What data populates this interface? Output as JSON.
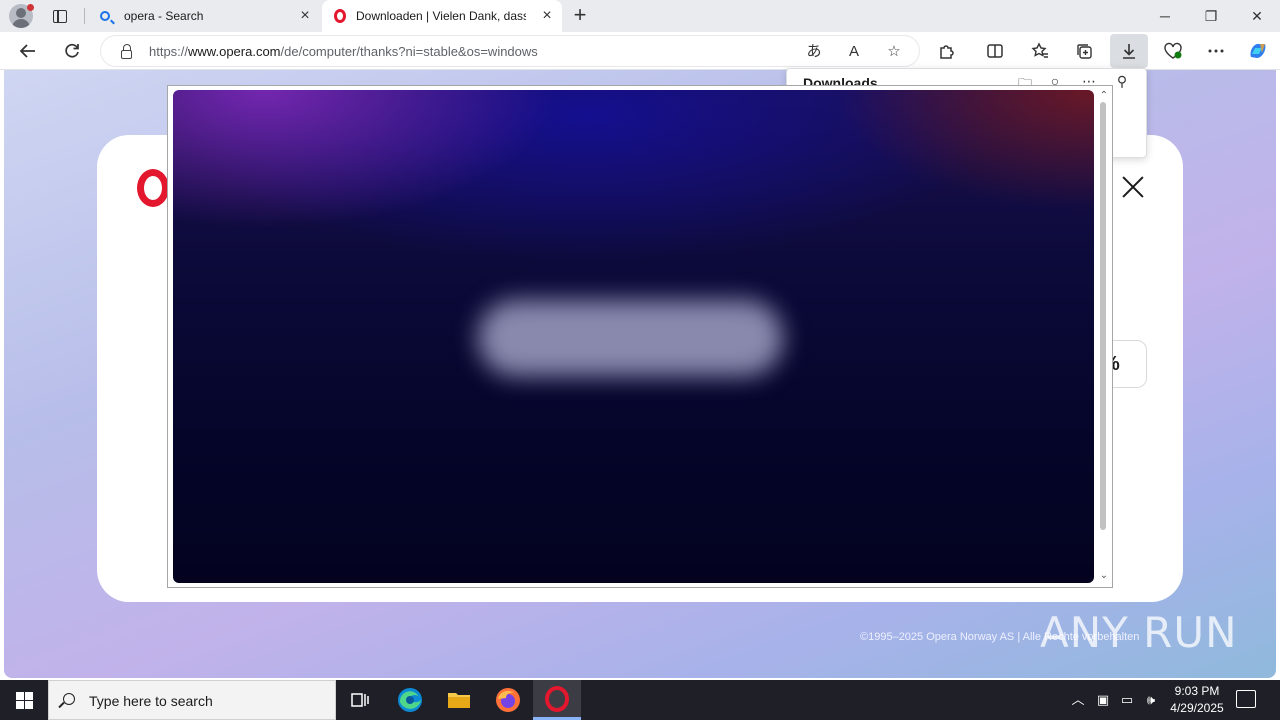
{
  "browser": {
    "tabs": [
      {
        "label": "opera - Search",
        "icon": "search-icon"
      },
      {
        "label": "Downloaden | Vielen Dank, dass Sie",
        "icon": "opera-icon",
        "active": true
      }
    ],
    "window_controls": {
      "minimize": "─",
      "restore": "❐",
      "close": "✕"
    },
    "address_bar": {
      "url_prefix": "https://",
      "url_domain": "www.opera.com",
      "url_path": "/de/computer/thanks?ni=stable&os=windows"
    }
  },
  "downloads_panel": {
    "title": "Downloads"
  },
  "page": {
    "percent_badge": "%",
    "copyright": "©1995–2025 Opera Norway AS | Alle Rechte vorbehalten",
    "watermark": "ANY RUN"
  },
  "taskbar": {
    "search_placeholder": "Type here to search",
    "time": "9:03 PM",
    "date": "4/29/2025"
  },
  "colors": {
    "opera_red": "#e3172d",
    "edge_blue": "#1a73e8",
    "taskbar": "#1f2027"
  }
}
